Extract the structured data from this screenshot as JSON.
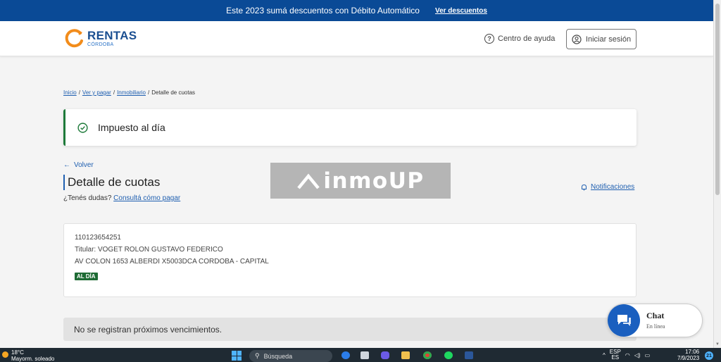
{
  "promo": {
    "text": "Este 2023 sumá descuentos con Débito Automático",
    "link": "Ver descuentos"
  },
  "header": {
    "logo_title": "RENTAS",
    "logo_subtitle": "CÓRDOBA",
    "help_label": "Centro de ayuda",
    "login_label": "Iniciar sesión"
  },
  "breadcrumb": {
    "items": [
      "Inicio",
      "Ver y pagar",
      "Inmobiliario"
    ],
    "current": "Detalle de cuotas"
  },
  "status": {
    "text": "Impuesto al día",
    "color": "#1e7a3a"
  },
  "back_label": "Volver",
  "page_title": "Detalle de cuotas",
  "doubts": {
    "question": "¿Tenés dudas?",
    "link": "Consultá cómo pagar"
  },
  "watermark": {
    "text": "inmoUP"
  },
  "notifications_label": "Notificaciones",
  "property": {
    "account": "110123654251",
    "holder": "Titular: VOGET ROLON GUSTAVO FEDERICO",
    "address": "AV COLON 1653 ALBERDI X5003DCA CORDOBA - CAPITAL",
    "badge": "AL DÍA"
  },
  "notice": "No se registran próximos vencimientos.",
  "chat": {
    "title": "Chat",
    "status": "En línea"
  },
  "taskbar": {
    "temperature": "18°C",
    "weather": "Mayorm. soleado",
    "search_placeholder": "Búsqueda",
    "lang": "ESP",
    "lang_sub": "ES",
    "time": "17:06",
    "date": "7/9/2023",
    "notifications": "21"
  },
  "colors": {
    "brand": "#0a4a96",
    "link": "#1f5fb0",
    "success": "#1e7a3a",
    "chat": "#1a5fbf"
  }
}
